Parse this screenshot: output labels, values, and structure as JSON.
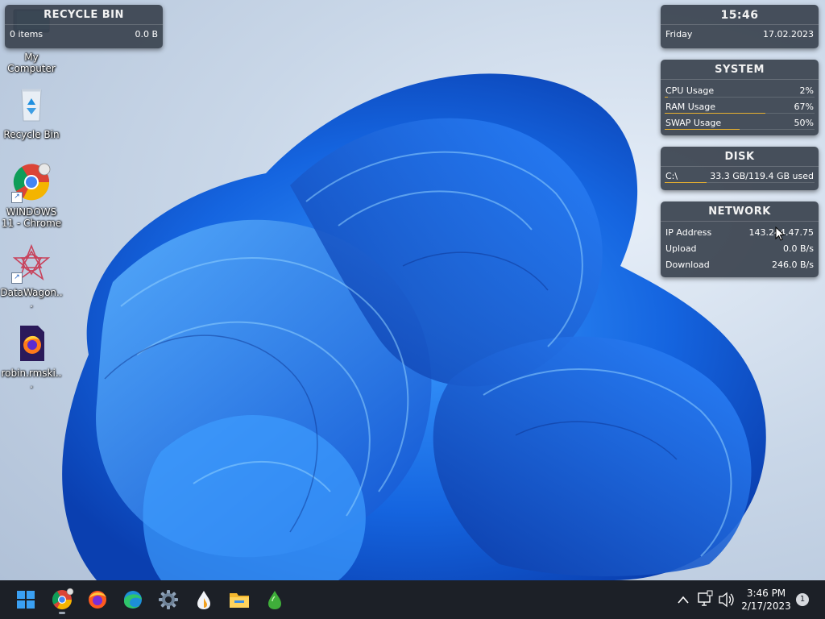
{
  "desktop_icons": [
    {
      "label": "My Computer",
      "icon": "computer-icon"
    },
    {
      "label": "Recycle Bin",
      "icon": "recycle-bin-icon"
    },
    {
      "label": "WINDOWS 11 - Chrome",
      "icon": "chrome-icon"
    },
    {
      "label": "DataWagon...",
      "icon": "datawagon-icon"
    },
    {
      "label": "robin.rmski...",
      "icon": "firefox-file-icon"
    }
  ],
  "widgets": {
    "recycle_bin": {
      "title": "RECYCLE BIN",
      "items": "0 items",
      "size": "0.0 B"
    },
    "clock": {
      "time": "15:46",
      "day": "Friday",
      "date": "17.02.2023"
    },
    "system": {
      "title": "SYSTEM",
      "rows": [
        {
          "label": "CPU Usage",
          "value": "2%",
          "level": 0.02
        },
        {
          "label": "RAM Usage",
          "value": "67%",
          "level": 0.67
        },
        {
          "label": "SWAP Usage",
          "value": "50%",
          "level": 0.5
        }
      ]
    },
    "disk": {
      "title": "DISK",
      "drive": "C:\\",
      "usage": "33.3 GB/119.4 GB used",
      "level": 0.28
    },
    "network": {
      "title": "NETWORK",
      "rows": [
        {
          "label": "IP Address",
          "value": "143.244.47.75"
        },
        {
          "label": "Upload",
          "value": "0.0 B/s"
        },
        {
          "label": "Download",
          "value": "246.0 B/s"
        }
      ]
    }
  },
  "taskbar": {
    "pinned": [
      {
        "icon": "windows-start-icon"
      },
      {
        "icon": "chrome-icon"
      },
      {
        "icon": "firefox-icon"
      },
      {
        "icon": "edge-icon"
      },
      {
        "icon": "settings-gear-icon"
      },
      {
        "icon": "water-drop-icon"
      },
      {
        "icon": "file-explorer-icon"
      },
      {
        "icon": "green-drop-icon"
      }
    ],
    "tray": {
      "time": "3:46 PM",
      "date": "2/17/2023",
      "notification_count": "1"
    }
  },
  "colors": {
    "widget_bg": "#3a424e",
    "bar_fill": "#e6b030",
    "taskbar_bg": "#1c2027",
    "wallpaper_blue": "#1a6ae8"
  }
}
